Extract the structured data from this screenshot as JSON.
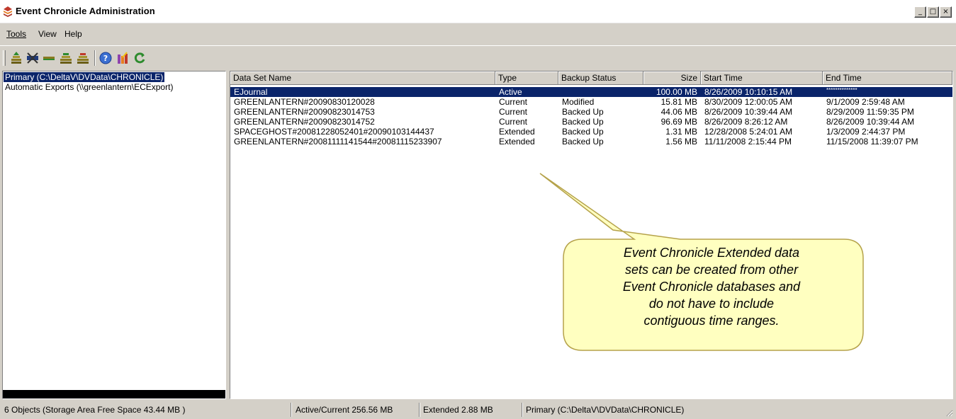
{
  "window": {
    "title": "Event Chronicle Administration",
    "controls": {
      "minimize": "_",
      "maximize": "□",
      "close": "×"
    }
  },
  "menu": [
    {
      "label": "Tools",
      "underline": "T"
    },
    {
      "label": "View"
    },
    {
      "label": "Help"
    }
  ],
  "toolbar": {
    "buttons": [
      "add-dataset-icon",
      "delete-icon",
      "flat-icon",
      "export-icon",
      "import-icon",
      "help-icon",
      "wizard-icon",
      "refresh-icon"
    ]
  },
  "tree": {
    "items": [
      {
        "label": "Primary  (C:\\DeltaV\\DVData\\CHRONICLE)",
        "selected": true
      },
      {
        "label": "Automatic Exports  (\\\\greenlantern\\ECExport)",
        "selected": false
      }
    ]
  },
  "table": {
    "columns": [
      "Data Set Name",
      "Type",
      "Backup Status",
      "Size",
      "Start Time",
      "End Time"
    ],
    "rows": [
      {
        "name": "EJournal",
        "type": "Active",
        "backup": "",
        "size": "100.00 MB",
        "start": "8/26/2009 10:10:15 AM",
        "end": "**************",
        "selected": true
      },
      {
        "name": "GREENLANTERN#20090830120028",
        "type": "Current",
        "backup": "Modified",
        "size": "15.81 MB",
        "start": "8/30/2009 12:00:05 AM",
        "end": "9/1/2009 2:59:48 AM"
      },
      {
        "name": "GREENLANTERN#20090823014753",
        "type": "Current",
        "backup": "Backed Up",
        "size": "44.06 MB",
        "start": "8/26/2009 10:39:44 AM",
        "end": "8/29/2009 11:59:35 PM"
      },
      {
        "name": "GREENLANTERN#20090823014752",
        "type": "Current",
        "backup": "Backed Up",
        "size": "96.69 MB",
        "start": "8/26/2009 8:26:12 AM",
        "end": "8/26/2009 10:39:44 AM"
      },
      {
        "name": "SPACEGHOST#20081228052401#20090103144437",
        "type": "Extended",
        "backup": "Backed Up",
        "size": "1.31 MB",
        "start": "12/28/2008 5:24:01 AM",
        "end": "1/3/2009 2:44:37 PM"
      },
      {
        "name": "GREENLANTERN#20081111141544#20081115233907",
        "type": "Extended",
        "backup": "Backed Up",
        "size": "1.56 MB",
        "start": "11/11/2008 2:15:44 PM",
        "end": "11/15/2008 11:39:07 PM"
      }
    ]
  },
  "callout": {
    "lines": [
      "Event Chronicle Extended data",
      "sets can be created from other",
      "Event Chronicle databases and",
      "do not have to include",
      "contiguous time ranges."
    ],
    "fill": "#ffffc0"
  },
  "status": {
    "objects": "6 Objects (Storage Area Free Space 43.44 MB )",
    "active": "Active/Current 256.56 MB",
    "extended": "Extended 2.88 MB",
    "location": "Primary  (C:\\DeltaV\\DVData\\CHRONICLE)"
  },
  "colors": {
    "selection": "#0a246a",
    "chrome": "#d4d0c8",
    "callout_border": "#b5a24a"
  }
}
